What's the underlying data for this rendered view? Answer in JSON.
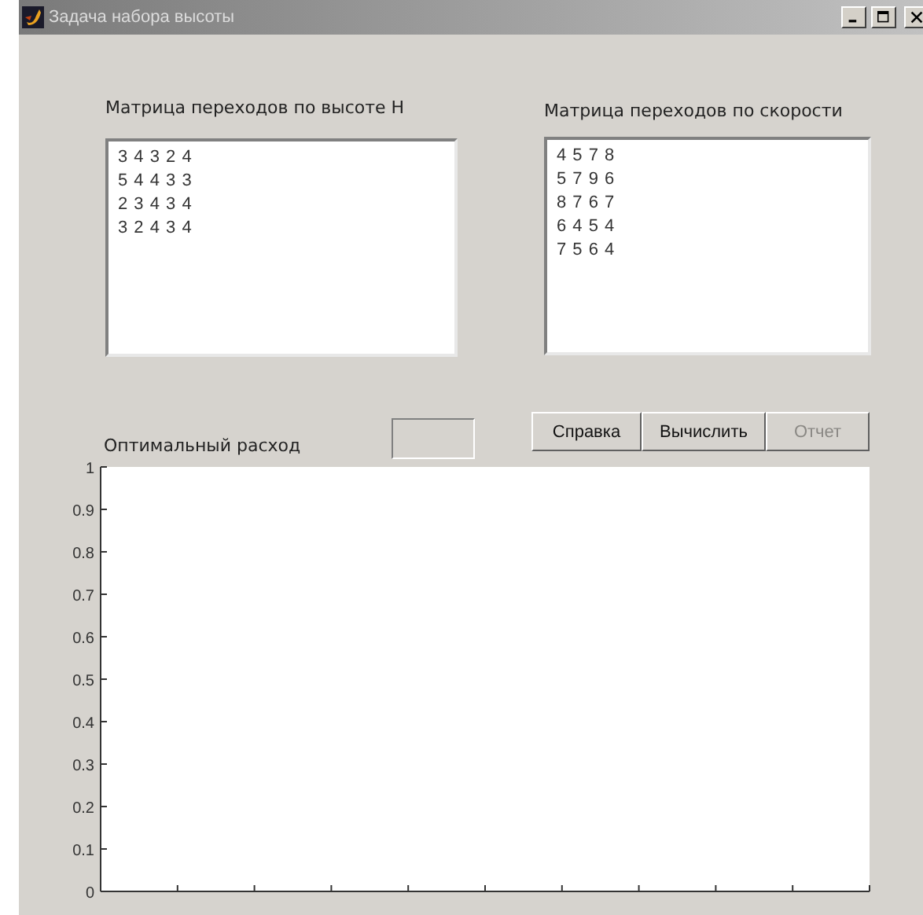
{
  "window": {
    "title": "Задача набора высоты"
  },
  "height_matrix": {
    "label": "Матрица переходов по высоте H",
    "lines": [
      "3 4 3 2 4",
      "5 4 4 3 3",
      "2 3 4 3 4",
      "3 2 4 3 4"
    ]
  },
  "speed_matrix": {
    "label": "Матрица переходов по скорости",
    "lines": [
      "4 5 7 8",
      "5 7 9 6",
      "8 7 6 7",
      "6 4 5 4",
      "7 5 6 4"
    ]
  },
  "optimal_cost": {
    "label": "Оптимальный расход"
  },
  "buttons": [
    {
      "label": "Справка",
      "disabled": false
    },
    {
      "label": "Вычислить",
      "disabled": false
    },
    {
      "label": "Отчет",
      "disabled": true
    }
  ],
  "plot": {
    "y_tick_labels": [
      "1",
      "0.9",
      "0.8",
      "0.7",
      "0.6",
      "0.5",
      "0.4",
      "0.3",
      "0.2",
      "0.1",
      "0"
    ]
  }
}
